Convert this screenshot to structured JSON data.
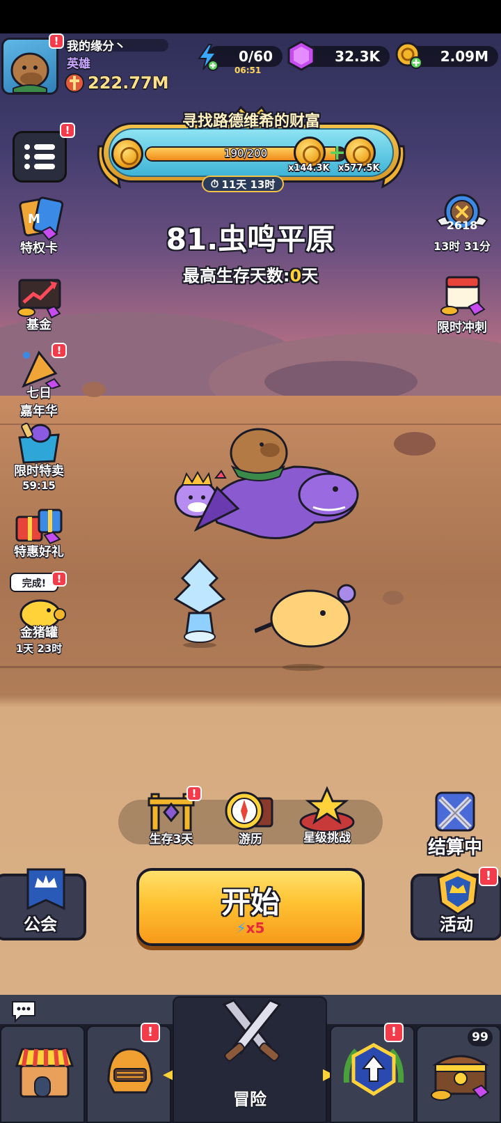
{
  "player": {
    "name": "我的缘分丶",
    "title": "英雄",
    "power": "222.77M"
  },
  "resources": {
    "energy": "0/60",
    "energy_timer": "06:51",
    "gems": "32.3K",
    "gold": "2.09M"
  },
  "event": {
    "title": "寻找路德维希的财富",
    "progress_text": "190/200",
    "progress": 0.95,
    "reward_1": "x144.3K",
    "reward_2": "x577.5K",
    "timer": "11天 13时"
  },
  "stage": {
    "title": "81.虫鸣平原",
    "survive_label": "最高生存天数:",
    "survive_value": "0",
    "survive_unit": "天"
  },
  "left_menu": [
    {
      "label": "特权卡"
    },
    {
      "label": "基金"
    },
    {
      "label": "七日",
      "label2": "嘉年华"
    },
    {
      "label": "限时特卖",
      "sub": "59:15"
    },
    {
      "label": "特惠好礼"
    },
    {
      "label": "金猪罐",
      "sub": "1天 23时",
      "bubble": "完成!"
    }
  ],
  "right_menu": {
    "arena_score": "2618",
    "arena_timer": "13时 31分",
    "sprint_label": "限时冲刺"
  },
  "modes": [
    {
      "label": "生存3天"
    },
    {
      "label": "游历"
    },
    {
      "label": "星级挑战"
    }
  ],
  "settlement_label": "结算中",
  "start": {
    "label": "开始",
    "cost": "x5"
  },
  "guild_label": "公会",
  "activity_label": "活动",
  "nav": {
    "center_label": "冒险",
    "chest_count": "99"
  },
  "badge": "!"
}
